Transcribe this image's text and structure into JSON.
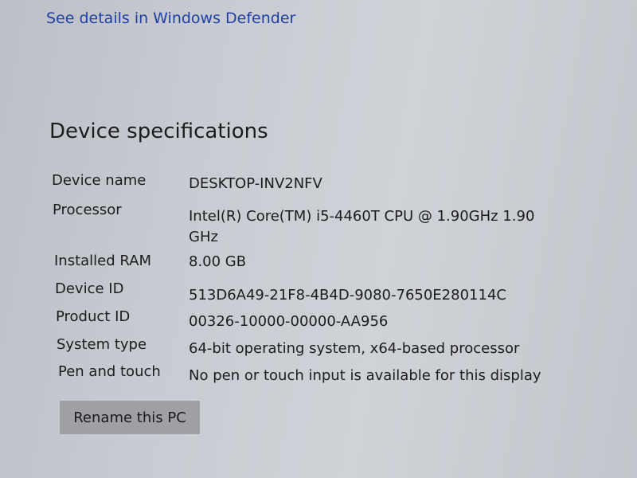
{
  "security": {
    "defender_link": "See details in Windows Defender"
  },
  "device_specs": {
    "title": "Device specifications",
    "rows": [
      {
        "label": "Device name",
        "value": "DESKTOP-INV2NFV"
      },
      {
        "label": "Processor",
        "value": "Intel(R) Core(TM) i5-4460T CPU @ 1.90GHz   1.90 GHz"
      },
      {
        "label": "Installed RAM",
        "value": "8.00 GB"
      },
      {
        "label": "Device ID",
        "value": "513D6A49-21F8-4B4D-9080-7650E280114C"
      },
      {
        "label": "Product ID",
        "value": "00326-10000-00000-AA956"
      },
      {
        "label": "System type",
        "value": "64-bit operating system, x64-based processor"
      },
      {
        "label": "Pen and touch",
        "value": "No pen or touch input is available for this display"
      }
    ],
    "rename_button": "Rename this PC"
  }
}
